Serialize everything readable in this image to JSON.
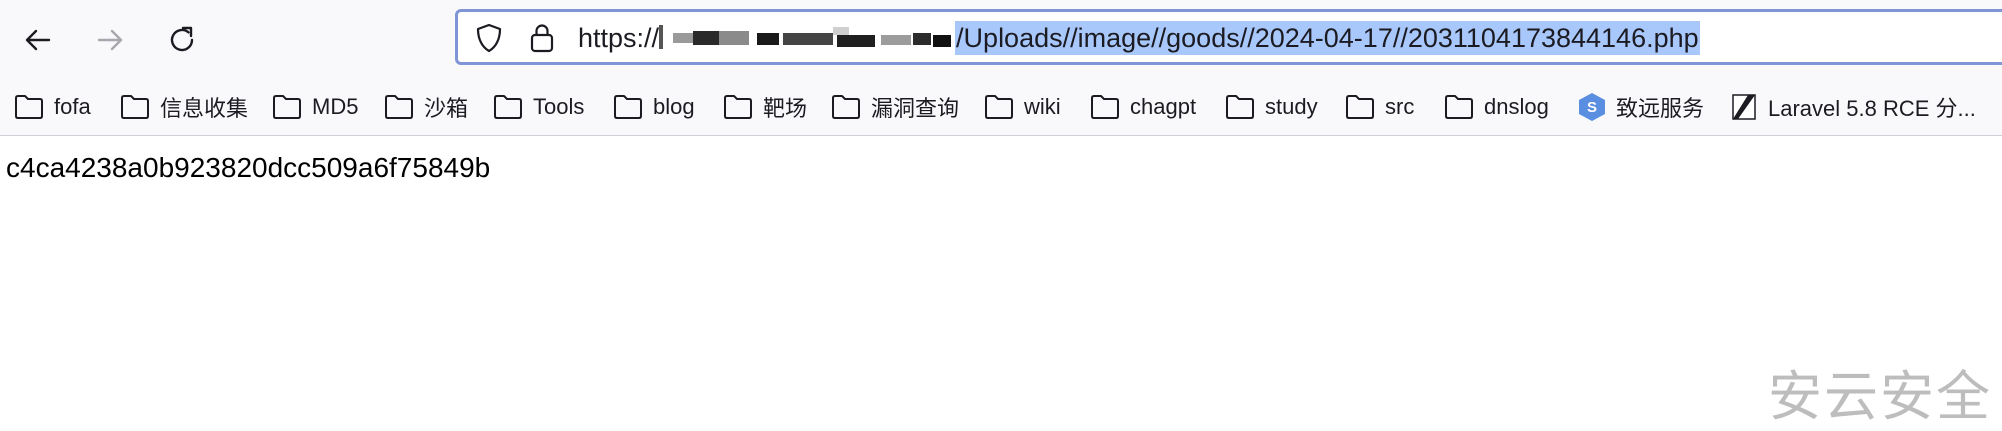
{
  "toolbar": {
    "back_icon": "arrow-left-icon",
    "forward_icon": "arrow-right-icon",
    "reload_icon": "reload-icon"
  },
  "urlbar": {
    "shield_icon": "tracking-protection-shield-icon",
    "lock_icon": "lock-icon",
    "url_prefix": "https://",
    "url_path_selected": "/Uploads//image//goods//2024-04-17//2031104173844146.php",
    "selection_color": "#a8c7fa",
    "border_color": "#7f95d6"
  },
  "bookmarks": [
    {
      "label": "fofa",
      "icon": "folder-icon"
    },
    {
      "label": "信息收集",
      "icon": "folder-icon"
    },
    {
      "label": "MD5",
      "icon": "folder-icon"
    },
    {
      "label": "沙箱",
      "icon": "folder-icon"
    },
    {
      "label": "Tools",
      "icon": "folder-icon"
    },
    {
      "label": "blog",
      "icon": "folder-icon"
    },
    {
      "label": "靶场",
      "icon": "folder-icon"
    },
    {
      "label": "漏洞查询",
      "icon": "folder-icon"
    },
    {
      "label": "wiki",
      "icon": "folder-icon"
    },
    {
      "label": "chagpt",
      "icon": "folder-icon"
    },
    {
      "label": "study",
      "icon": "folder-icon"
    },
    {
      "label": "src",
      "icon": "folder-icon"
    },
    {
      "label": "dnslog",
      "icon": "folder-icon"
    },
    {
      "label": "致远服务",
      "icon": "seeyon-s-icon"
    },
    {
      "label": "Laravel 5.8 RCE 分...",
      "icon": "laravel-slash-icon"
    }
  ],
  "page": {
    "body_text": "c4ca4238a0b923820dcc509a6f75849b"
  },
  "watermark": {
    "text": "安云安全"
  }
}
